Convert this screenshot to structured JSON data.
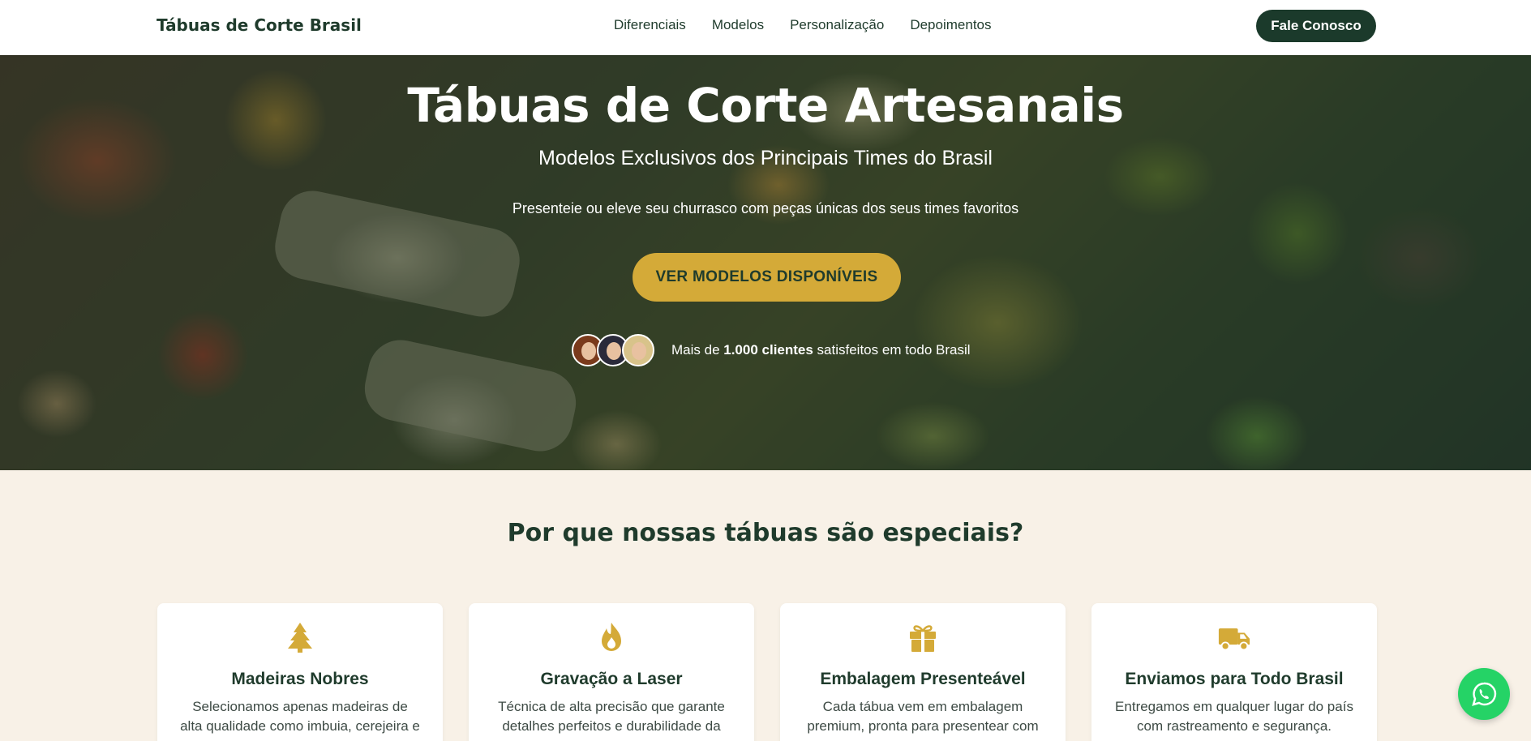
{
  "header": {
    "logo": "Tábuas de Corte Brasil",
    "nav": [
      "Diferenciais",
      "Modelos",
      "Personalização",
      "Depoimentos"
    ],
    "cta": "Fale Conosco"
  },
  "hero": {
    "title": "Tábuas de Corte Artesanais",
    "subtitle": "Modelos Exclusivos dos Principais Times do Brasil",
    "description": "Presenteie ou eleve seu churrasco com peças únicas dos seus times favoritos",
    "button": "VER MODELOS DISPONÍVEIS",
    "social_prefix": "Mais de ",
    "social_bold": "1.000 clientes",
    "social_suffix": " satisfeitos em todo Brasil"
  },
  "features": {
    "title": "Por que nossas tábuas são especiais?",
    "cards": [
      {
        "icon": "tree-icon",
        "title": "Madeiras Nobres",
        "text": "Selecionamos apenas madeiras de alta qualidade como imbuia, cerejeira e"
      },
      {
        "icon": "fire-icon",
        "title": "Gravação a Laser",
        "text": "Técnica de alta precisão que garante detalhes perfeitos e durabilidade da"
      },
      {
        "icon": "gift-icon",
        "title": "Embalagem Presenteável",
        "text": "Cada tábua vem em embalagem premium, pronta para presentear com"
      },
      {
        "icon": "truck-icon",
        "title": "Enviamos para Todo Brasil",
        "text": "Entregamos em qualquer lugar do país com rastreamento e segurança."
      }
    ]
  },
  "colors": {
    "primary_dark": "#1b3a2b",
    "accent_gold": "#d4aa38",
    "background_cream": "#f8f1e7",
    "whatsapp_green": "#25d366"
  },
  "floating": {
    "icon": "whatsapp-icon"
  }
}
